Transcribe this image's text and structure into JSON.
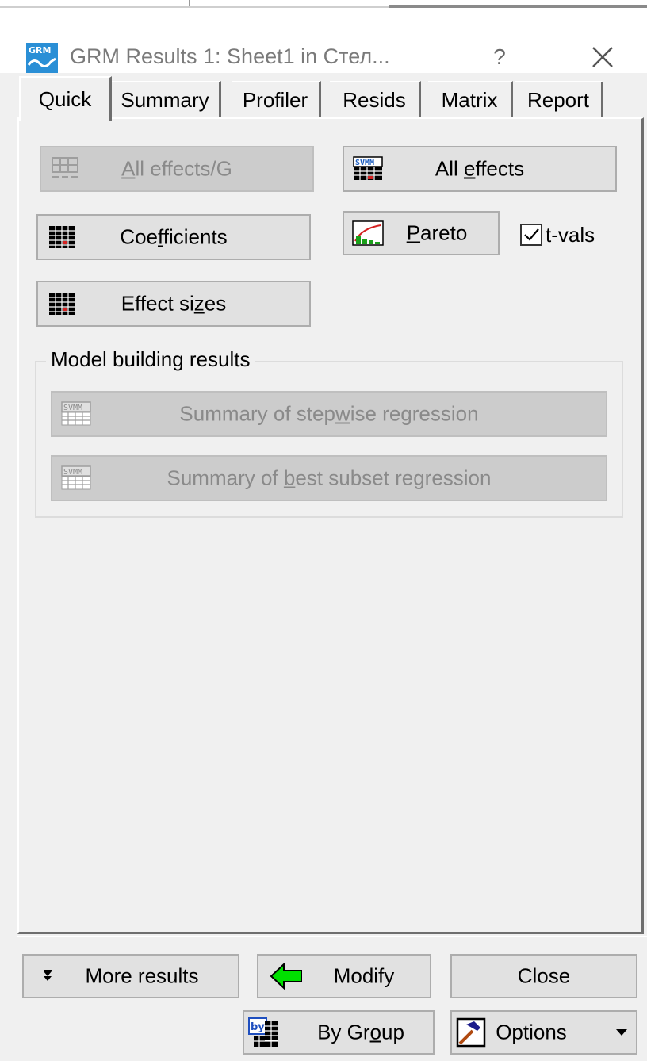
{
  "window": {
    "title": "GRM Results 1: Sheet1 in Стел...",
    "help_glyph": "?",
    "icon": "grm-app-icon"
  },
  "tabs": [
    {
      "label": "Quick",
      "active": true
    },
    {
      "label": "Summary",
      "active": false
    },
    {
      "label": "Profiler",
      "active": false
    },
    {
      "label": "Resids",
      "active": false
    },
    {
      "label": "Matrix",
      "active": false
    },
    {
      "label": "Report",
      "active": false
    }
  ],
  "quick": {
    "all_effects_g": {
      "label_u": "A",
      "label_rest": "ll effects/G",
      "enabled": false
    },
    "all_effects": {
      "label_a": "All ",
      "label_u": "e",
      "label_rest": "ffects",
      "enabled": true
    },
    "coefficients": {
      "label_a": "Coe",
      "label_u": "f",
      "label_rest": "ficients",
      "enabled": true
    },
    "pareto": {
      "label_u": "P",
      "label_rest": "areto",
      "enabled": true
    },
    "tvals": {
      "label": "t-vals",
      "checked": true
    },
    "effect_sizes": {
      "label_a": "Effect si",
      "label_u": "z",
      "label_rest": "es",
      "enabled": true
    }
  },
  "model_building": {
    "title": "Model building results",
    "stepwise": {
      "label_a": "Summary of step",
      "label_u": "w",
      "label_rest": "ise regression",
      "enabled": false
    },
    "best_subset": {
      "label_a": "Summary of ",
      "label_u": "b",
      "label_rest": "est subset regression",
      "enabled": false
    }
  },
  "footer": {
    "more_results": "More results",
    "modify": "Modify",
    "close": "Close",
    "by_group": {
      "label_a": "By Gr",
      "label_u": "o",
      "label_rest": "up"
    },
    "options": "Options",
    "by_icon_text": "by"
  }
}
